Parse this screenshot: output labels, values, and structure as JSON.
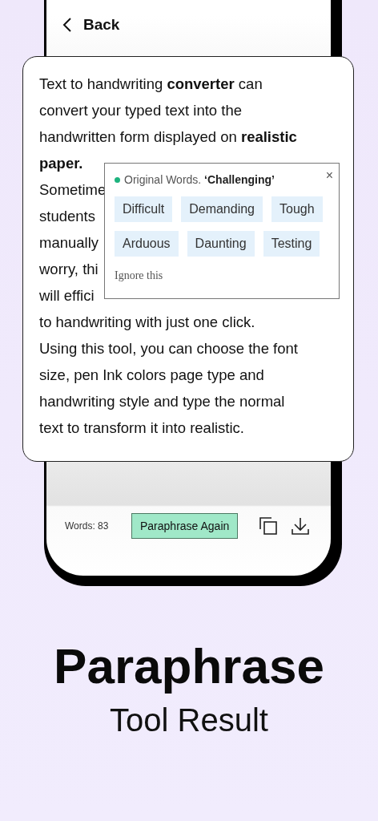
{
  "header": {
    "back_label": "Back"
  },
  "result_text": {
    "lines": [
      "Text to handwriting **converter** can",
      "convert your typed text into the",
      "handwritten form displayed on **realistic**",
      "**paper.**",
      "Sometime",
      "students",
      "manually",
      "worry, thi",
      "will effici",
      "to handwriting with just one click.",
      "Using this tool, you can choose the font",
      "size, pen Ink colors page type and",
      "handwriting style and type the normal",
      "text to transform it into realistic."
    ]
  },
  "suggestion_popup": {
    "label": "Original Words.",
    "original_word": "‘Challenging’",
    "close": "×",
    "synonyms": [
      "Difficult",
      "Demanding",
      "Tough",
      "Arduous",
      "Daunting",
      "Testing"
    ],
    "ignore": "Ignore this"
  },
  "footer": {
    "word_count": "Words: 83",
    "action": "Paraphrase Again"
  },
  "caption": {
    "title": "Paraphrase",
    "subtitle": "Tool Result"
  }
}
